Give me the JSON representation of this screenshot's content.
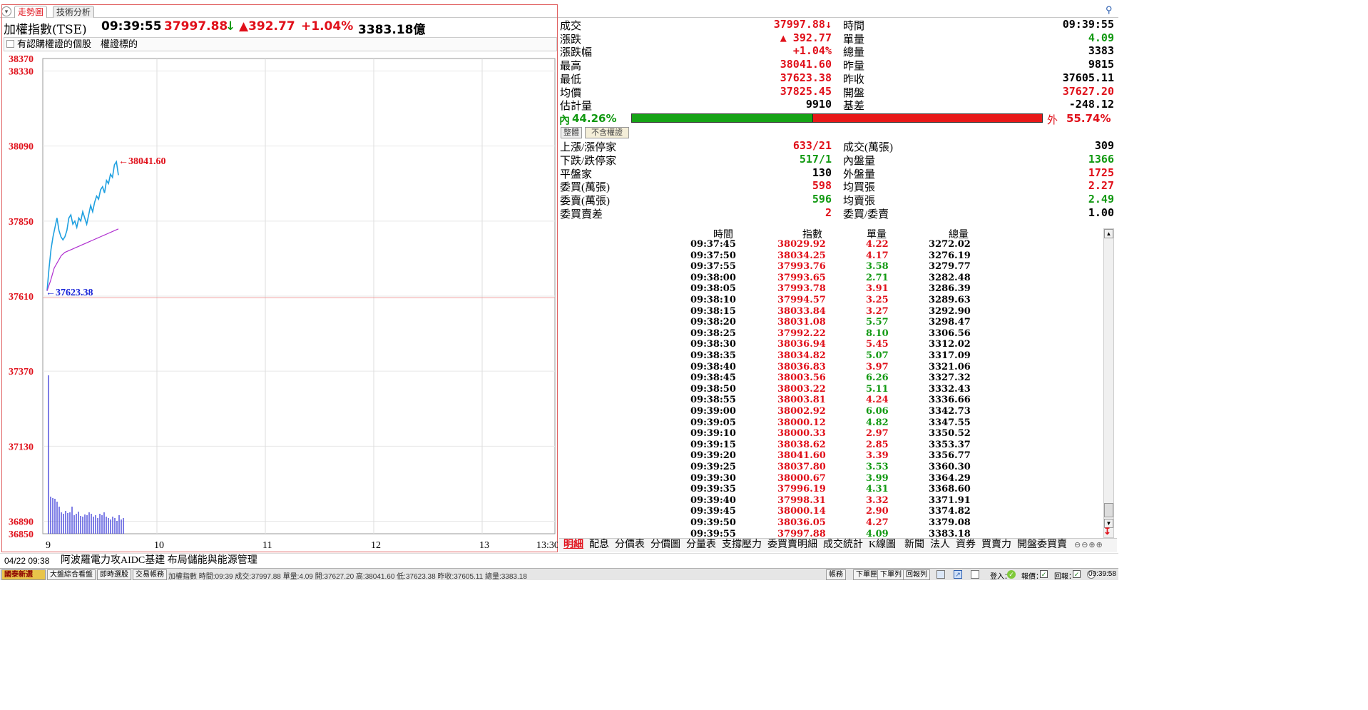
{
  "tabs": [
    "走勢圖",
    "技術分析"
  ],
  "header": {
    "index_name": "加權指數(TSE)",
    "time": "09:39:55",
    "price": "37997.88",
    "price_arrow": "↓",
    "change": "▲392.77",
    "pct": "+1.04%",
    "volume": "3383.18億"
  },
  "filter": {
    "checkbox_label": "有認購權證的個股",
    "link_label": "權證標的"
  },
  "chart": {
    "y_ticks_top": [
      "38370",
      "38330",
      "38090",
      "37850",
      "37610",
      "37370",
      "37130",
      "36890",
      "36850"
    ],
    "x_ticks": [
      "9",
      "10",
      "11",
      "12",
      "13",
      "13:30"
    ],
    "high_label": "←38041.60",
    "low_label": "←37623.38"
  },
  "chart_data": {
    "type": "line",
    "title": "",
    "xlabel": "",
    "ylabel": "",
    "ylim": [
      36850,
      38370
    ],
    "prev_close": 37605.11,
    "high": 38041.6,
    "low": 37623.38,
    "series": [
      {
        "values": [
          37627,
          37700,
          37760,
          37800,
          37830,
          37860,
          37820,
          37800,
          37790,
          37800,
          37820,
          37860,
          37870,
          37840,
          37850,
          37830,
          37860,
          37850,
          37880,
          37860,
          37840,
          37870,
          37900,
          37880,
          37910,
          37930,
          37920,
          37950,
          37960,
          37940,
          37980,
          37970,
          38000,
          37990,
          38030,
          38040,
          37997
        ]
      },
      {
        "values": [
          37627,
          37660,
          37700,
          37720,
          37740,
          37750,
          37755,
          37760,
          37765,
          37770,
          37775,
          37780,
          37785,
          37790,
          37795,
          37800,
          37805,
          37810,
          37815,
          37820,
          37825
        ]
      }
    ]
  },
  "stats_left": [
    {
      "label": "成交",
      "value": "37997.88↓",
      "color": "#e0101a"
    },
    {
      "label": "漲跌",
      "value": "▲  392.77",
      "color": "#e0101a"
    },
    {
      "label": "漲跌幅",
      "value": "+1.04%",
      "color": "#e0101a"
    },
    {
      "label": "最高",
      "value": "38041.60",
      "color": "#e0101a"
    },
    {
      "label": "最低",
      "value": "37623.38",
      "color": "#e0101a"
    },
    {
      "label": "均價",
      "value": "37825.45",
      "color": "#e0101a"
    },
    {
      "label": "估計量",
      "value": "9910",
      "color": "#000000"
    }
  ],
  "stats_right": [
    {
      "label": "時間",
      "value": "09:39:55",
      "color": "#000000"
    },
    {
      "label": "單量",
      "value": "4.09",
      "color": "#119911"
    },
    {
      "label": "總量",
      "value": "3383",
      "color": "#000000"
    },
    {
      "label": "昨量",
      "value": "9815",
      "color": "#000000"
    },
    {
      "label": "昨收",
      "value": "37605.11",
      "color": "#000000"
    },
    {
      "label": "開盤",
      "value": "37627.20",
      "color": "#e0101a"
    },
    {
      "label": "基差",
      "value": "-248.12",
      "color": "#000000"
    }
  ],
  "ratio": {
    "inner_label": "內",
    "inner_pct": "44.26%",
    "outer_label": "外",
    "outer_pct": "55.74%",
    "inner_fraction": 0.4426
  },
  "mini_buttons": [
    "整體",
    "不含權證"
  ],
  "breadth_left": [
    {
      "label": "上漲/漲停家",
      "value": "633/21",
      "color": "#e0101a"
    },
    {
      "label": "下跌/跌停家",
      "value": "517/1",
      "color": "#119911"
    },
    {
      "label": "平盤家",
      "value": "130",
      "color": "#000000"
    },
    {
      "label": "委買(萬張)",
      "value": "598",
      "color": "#e0101a"
    },
    {
      "label": "委賣(萬張)",
      "value": "596",
      "color": "#119911"
    },
    {
      "label": "委買賣差",
      "value": "2",
      "color": "#e0101a"
    }
  ],
  "breadth_right": [
    {
      "label": "成交(萬張)",
      "value": "309",
      "color": "#000000"
    },
    {
      "label": "內盤量",
      "value": "1366",
      "color": "#119911"
    },
    {
      "label": "外盤量",
      "value": "1725",
      "color": "#e0101a"
    },
    {
      "label": "均買張",
      "value": "2.27",
      "color": "#e0101a"
    },
    {
      "label": "均賣張",
      "value": "2.49",
      "color": "#119911"
    },
    {
      "label": "委買/委賣",
      "value": "1.00",
      "color": "#000000"
    }
  ],
  "ticks_table": {
    "headers": [
      "時間",
      "指數",
      "單量",
      "總量"
    ],
    "rows": [
      [
        "09:37:45",
        "38029.92",
        "4.22",
        "3272.02",
        "r"
      ],
      [
        "09:37:50",
        "38034.25",
        "4.17",
        "3276.19",
        "r"
      ],
      [
        "09:37:55",
        "37993.76",
        "3.58",
        "3279.77",
        "g"
      ],
      [
        "09:38:00",
        "37993.65",
        "2.71",
        "3282.48",
        "g"
      ],
      [
        "09:38:05",
        "37993.78",
        "3.91",
        "3286.39",
        "r"
      ],
      [
        "09:38:10",
        "37994.57",
        "3.25",
        "3289.63",
        "r"
      ],
      [
        "09:38:15",
        "38033.84",
        "3.27",
        "3292.90",
        "r"
      ],
      [
        "09:38:20",
        "38031.08",
        "5.57",
        "3298.47",
        "g"
      ],
      [
        "09:38:25",
        "37992.22",
        "8.10",
        "3306.56",
        "g"
      ],
      [
        "09:38:30",
        "38036.94",
        "5.45",
        "3312.02",
        "r"
      ],
      [
        "09:38:35",
        "38034.82",
        "5.07",
        "3317.09",
        "g"
      ],
      [
        "09:38:40",
        "38036.83",
        "3.97",
        "3321.06",
        "r"
      ],
      [
        "09:38:45",
        "38003.56",
        "6.26",
        "3327.32",
        "g"
      ],
      [
        "09:38:50",
        "38003.22",
        "5.11",
        "3332.43",
        "g"
      ],
      [
        "09:38:55",
        "38003.81",
        "4.24",
        "3336.66",
        "r"
      ],
      [
        "09:39:00",
        "38002.92",
        "6.06",
        "3342.73",
        "g"
      ],
      [
        "09:39:05",
        "38000.12",
        "4.82",
        "3347.55",
        "g"
      ],
      [
        "09:39:10",
        "38000.33",
        "2.97",
        "3350.52",
        "r"
      ],
      [
        "09:39:15",
        "38038.62",
        "2.85",
        "3353.37",
        "r"
      ],
      [
        "09:39:20",
        "38041.60",
        "3.39",
        "3356.77",
        "r"
      ],
      [
        "09:39:25",
        "38037.80",
        "3.53",
        "3360.30",
        "g"
      ],
      [
        "09:39:30",
        "38000.67",
        "3.99",
        "3364.29",
        "g"
      ],
      [
        "09:39:35",
        "37996.19",
        "4.31",
        "3368.60",
        "g"
      ],
      [
        "09:39:40",
        "37998.31",
        "3.32",
        "3371.91",
        "r"
      ],
      [
        "09:39:45",
        "38000.14",
        "2.90",
        "3374.82",
        "r"
      ],
      [
        "09:39:50",
        "38036.05",
        "4.27",
        "3379.08",
        "r"
      ],
      [
        "09:39:55",
        "37997.88",
        "4.09",
        "3383.18",
        "g"
      ]
    ]
  },
  "bottom_tabs": [
    "明細",
    "配息",
    "分價表",
    "分價圖",
    "分量表",
    "支撐壓力",
    "委買賣明細",
    "成交統計",
    "K線圖",
    "新聞",
    "法人",
    "資券",
    "買賣力",
    "開盤委買賣"
  ],
  "news": {
    "date": "04/22 09:38",
    "headline": "阿波羅電力攻AIDC基建 布局儲能與能源管理"
  },
  "statusbar": {
    "buttons": [
      "國泰新選",
      "大盤綜合看盤",
      "即時選股",
      "交易帳務"
    ],
    "ticker": "加權指數 時間:09:39 成交:37997.88 單量:4.09 開:37627.20 高:38041.60 低:37623.38 昨收:37605.11 總量:3383.18",
    "right_buttons": [
      "帳務",
      "下單匣",
      "下單列",
      "回報列"
    ],
    "login_label": "登入：",
    "report_label": "報價：",
    "reply_label": "回報：",
    "clock": "09:39:58"
  }
}
